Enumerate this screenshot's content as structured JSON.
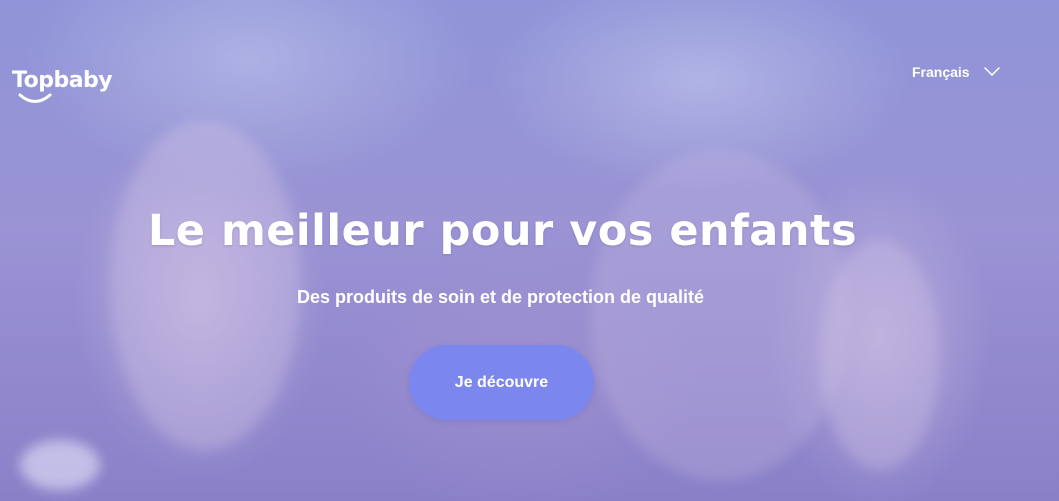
{
  "header": {
    "logo_text": "Topbaby",
    "language": {
      "selected": "Français",
      "icon": "chevron-down-icon"
    }
  },
  "hero": {
    "headline": "Le meilleur pour vos enfants",
    "subtitle": "Des produits de soin et de protection de qualité",
    "cta_label": "Je découvre"
  },
  "colors": {
    "overlay": "#8f95d8",
    "cta_background": "#7b86ee",
    "text": "#ffffff"
  }
}
